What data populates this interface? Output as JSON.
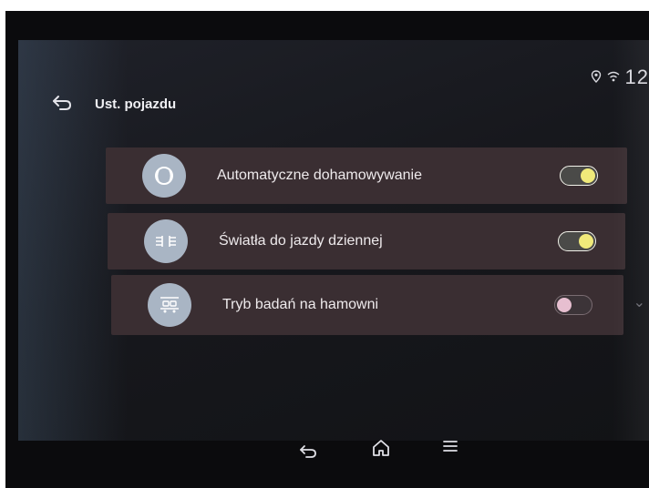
{
  "header": {
    "title": "Ust. pojazdu"
  },
  "status": {
    "location_icon": "location-pin-icon",
    "wifi_icon": "wifi-icon",
    "time_partial": "12"
  },
  "settings": [
    {
      "label": "Automatyczne dohamowywanie",
      "icon": "brake-disc-icon",
      "enabled": true
    },
    {
      "label": "Światła do jazdy dziennej",
      "icon": "daytime-lights-icon",
      "enabled": true
    },
    {
      "label": "Tryb badań na hamowni",
      "icon": "dyno-test-icon",
      "enabled": false
    }
  ],
  "nav": {
    "back_icon": "back-arrow-icon",
    "home_icon": "home-icon",
    "menu_icon": "menu-icon"
  },
  "colors": {
    "row_background": "#3a2e32",
    "toggle_on_knob": "#f0ea7a",
    "toggle_off_knob": "#e7bfd0",
    "icon_circle": "#a9b5c4"
  }
}
